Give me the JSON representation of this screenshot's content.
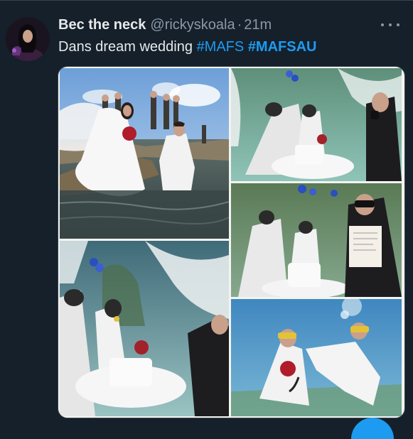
{
  "tweet": {
    "display_name": "Bec the neck",
    "handle": "@rickyskoala",
    "separator": "·",
    "timestamp": "21m",
    "text_plain": "Dans dream wedding ",
    "hashtag_1": "#MAFS",
    "hashtag_2": "#MAFSAU"
  },
  "media": {
    "photos": [
      "Bride and groom in wedding clothes standing in shallow water at a rocky shore",
      "Underwater couple in scuba masks with cake",
      "Underwater couple with officiant holding certificate",
      "Underwater couple cutting wedding cake",
      "Couple swimming underwater with bouquet"
    ]
  },
  "colors": {
    "background": "#15202b",
    "text": "#e7e9ea",
    "muted": "#8b98a5",
    "link": "#1d9bf0",
    "border": "#38444d"
  },
  "icons": [
    "more-options-icon",
    "compose-fab-icon"
  ]
}
